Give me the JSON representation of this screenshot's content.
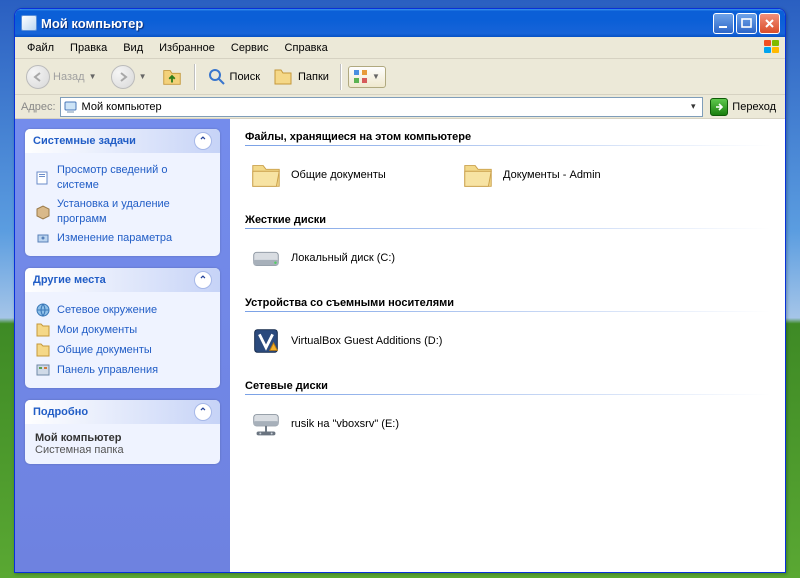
{
  "window": {
    "title": "Мой компьютер"
  },
  "menu": {
    "file": "Файл",
    "edit": "Правка",
    "view": "Вид",
    "favorites": "Избранное",
    "tools": "Сервис",
    "help": "Справка"
  },
  "toolbar": {
    "back": "Назад",
    "search": "Поиск",
    "folders": "Папки"
  },
  "address": {
    "label": "Адрес:",
    "value": "Мой компьютер",
    "go": "Переход"
  },
  "side": {
    "tasks": {
      "title": "Системные задачи",
      "items": [
        "Просмотр сведений о системе",
        "Установка и удаление программ",
        "Изменение параметра"
      ]
    },
    "places": {
      "title": "Другие места",
      "items": [
        "Сетевое окружение",
        "Мои документы",
        "Общие документы",
        "Панель управления"
      ]
    },
    "details": {
      "title": "Подробно",
      "name": "Мой компьютер",
      "type": "Системная папка"
    }
  },
  "content": {
    "cats": [
      {
        "title": "Файлы, хранящиеся на этом компьютере",
        "items": [
          {
            "icon": "folder",
            "label": "Общие документы"
          },
          {
            "icon": "folder",
            "label": "Документы - Admin"
          }
        ]
      },
      {
        "title": "Жесткие диски",
        "items": [
          {
            "icon": "hdd",
            "label": "Локальный диск (C:)"
          }
        ]
      },
      {
        "title": "Устройства со съемными носителями",
        "items": [
          {
            "icon": "vbox",
            "label": "VirtualBox Guest Additions (D:)"
          }
        ]
      },
      {
        "title": "Сетевые диски",
        "items": [
          {
            "icon": "netdrive",
            "label": "rusik на \"vboxsrv\" (E:)"
          }
        ]
      }
    ]
  }
}
